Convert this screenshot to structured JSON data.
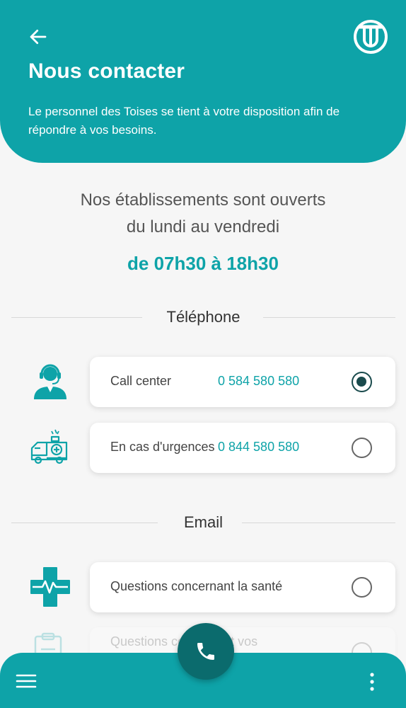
{
  "header": {
    "title": "Nous contacter",
    "subtitle": "Le personnel des Toises se tient à votre disposition afin de répondre à vos besoins."
  },
  "hours": {
    "line1": "Nos établissements sont ouverts",
    "line2": "du lundi au vendredi",
    "time": "de 07h30 à 18h30"
  },
  "telephone": {
    "heading": "Téléphone",
    "items": [
      {
        "label": "Call center",
        "phone": "0 584 580 580",
        "selected": true,
        "icon": "call-center-agent-icon"
      },
      {
        "label": "En cas d'urgences",
        "phone": "0 844 580 580",
        "selected": false,
        "icon": "ambulance-icon"
      }
    ]
  },
  "email": {
    "heading": "Email",
    "items": [
      {
        "label": "Questions concernant la santé",
        "selected": false,
        "icon": "medical-cross-icon"
      },
      {
        "label": "Questions concernant vos",
        "selected": false,
        "icon": "clipboard-icon"
      }
    ]
  },
  "colors": {
    "accent": "#0ea3a8",
    "accent_dark": "#0b6b6d"
  }
}
